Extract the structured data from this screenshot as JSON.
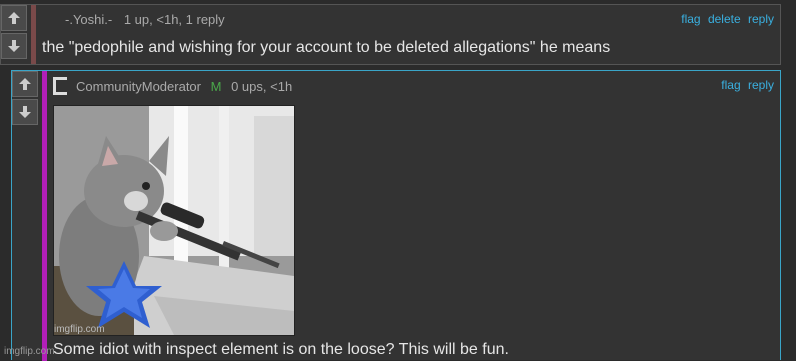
{
  "comments": [
    {
      "author": "-.Yoshi.-",
      "meta": "1 up, <1h, 1 reply",
      "text": "the \"pedophile and wishing for your account to be deleted allegations\" he means",
      "actions": [
        "flag",
        "delete",
        "reply"
      ]
    },
    {
      "author": "CommunityModerator",
      "badge": "M",
      "meta": "0 ups, <1h",
      "text": "Some idiot with inspect element is on the loose? This will be fun.",
      "actions": [
        "flag",
        "reply"
      ],
      "image_watermark": "imgflip.com"
    }
  ],
  "site_watermark": "imgflip.com",
  "colors": {
    "link": "#3ab0e0",
    "mod_badge": "#4aa84a",
    "mod_bar": "#b21fb8",
    "reply_border": "#3aa5c8"
  }
}
